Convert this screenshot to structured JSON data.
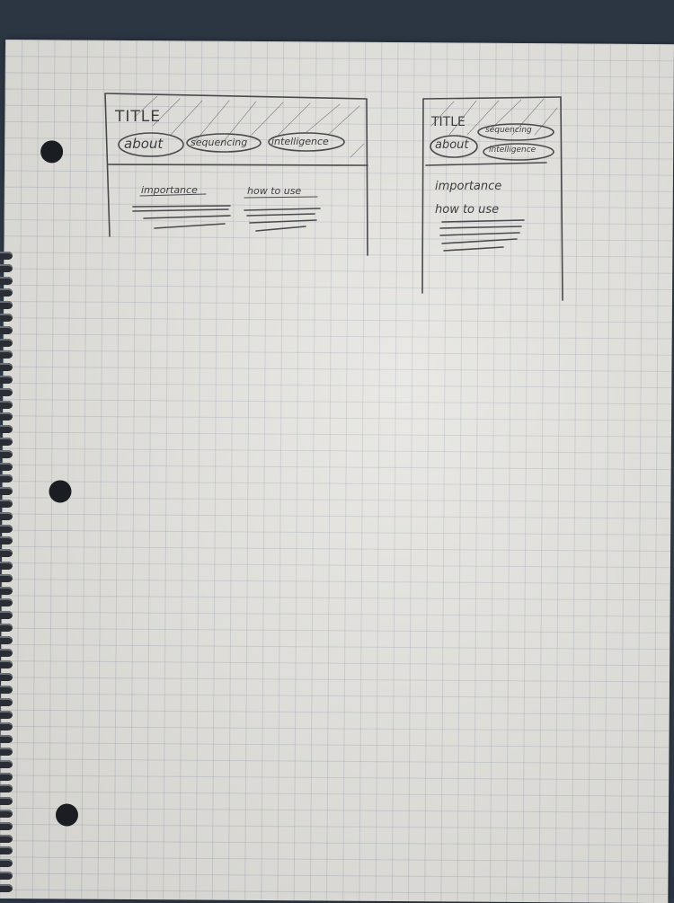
{
  "sketch_desktop": {
    "title": "TITLE",
    "buttons": [
      "about",
      "sequencing",
      "intelligence"
    ],
    "columns": [
      "importance",
      "how to use"
    ]
  },
  "sketch_mobile": {
    "title": "TITLE",
    "buttons": [
      "about",
      "sequencing",
      "intelligence"
    ],
    "items": [
      "importance",
      "how to use"
    ]
  },
  "colors": {
    "pencil": "#3d3d3f",
    "paper": "#e4e3de",
    "backdrop": "#2d3845"
  }
}
